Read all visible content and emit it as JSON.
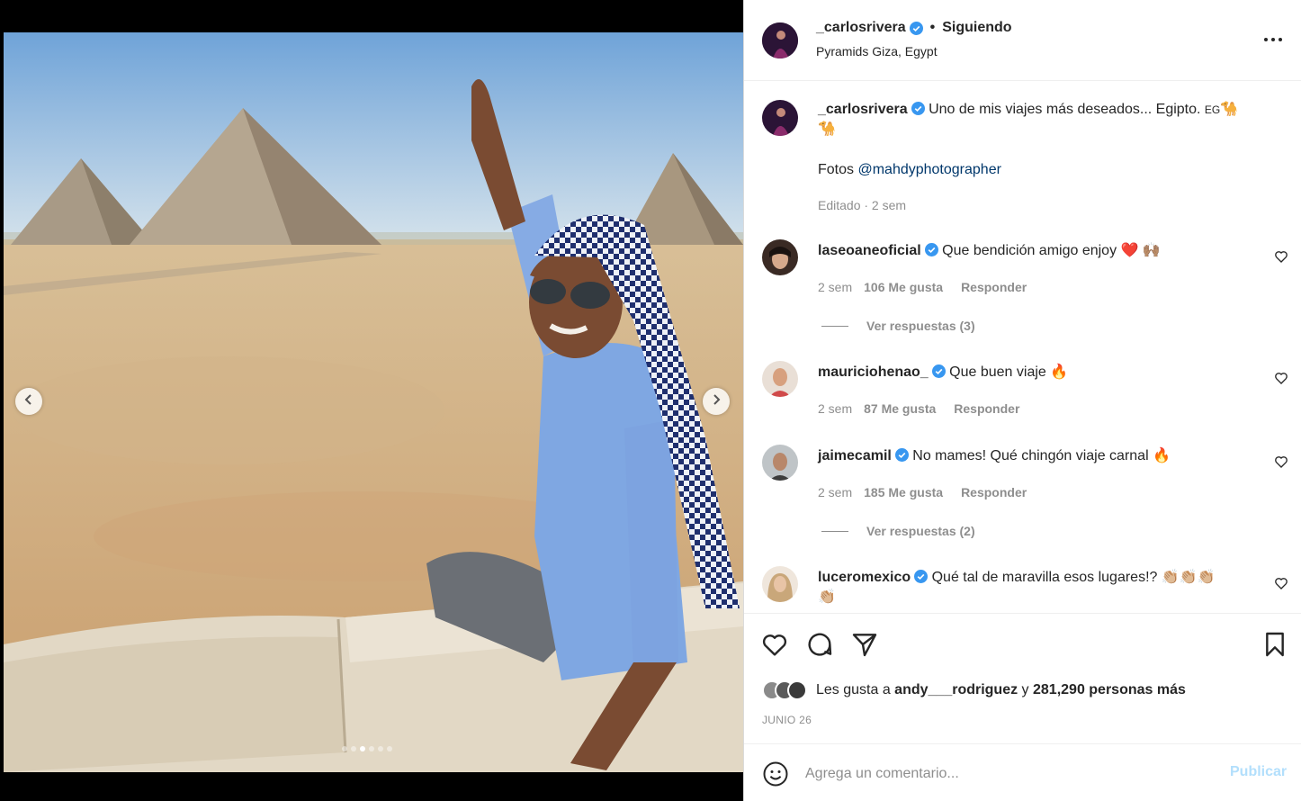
{
  "post": {
    "author": "_carlosrivera",
    "separator": "•",
    "follow_status": "Siguiendo",
    "location": "Pyramids Giza, Egypt"
  },
  "caption": {
    "author": "_carlosrivera",
    "text": "Uno de mis viajes más deseados... Egipto.",
    "flag": "EG",
    "emoji_1": "🐪",
    "emoji_2": "🐪",
    "credit_prefix": "Fotos ",
    "credit_handle": "@mahdyphotographer",
    "meta": "Editado · 2 sem"
  },
  "comments": [
    {
      "user": "laseoaneoficial",
      "text": "Que bendición amigo enjoy",
      "emoji": "❤️ 🙌🏽",
      "age": "2 sem",
      "likes": "106 Me gusta",
      "reply": "Responder",
      "view_replies": "Ver respuestas (3)"
    },
    {
      "user": "mauriciohenao_",
      "text": "Que buen viaje",
      "emoji": "🔥",
      "age": "2 sem",
      "likes": "87 Me gusta",
      "reply": "Responder"
    },
    {
      "user": "jaimecamil",
      "text": "No mames! Qué chingón viaje carnal",
      "emoji": "🔥",
      "age": "2 sem",
      "likes": "185 Me gusta",
      "reply": "Responder",
      "view_replies": "Ver respuestas (2)"
    },
    {
      "user": "luceromexico",
      "text": "Qué tal de maravilla esos lugares!?",
      "emoji": "👏🏼👏🏼👏🏼",
      "emoji_wrap": "👏🏼"
    }
  ],
  "likes": {
    "prefix": "Les gusta a ",
    "user": "andy___rodriguez",
    "middle": " y ",
    "count": "281,290 personas más"
  },
  "date": "JUNIO 26",
  "comment_box": {
    "placeholder": "Agrega un comentario...",
    "publish": "Publicar"
  },
  "carousel": {
    "total": 6,
    "active": 3
  },
  "colors": {
    "verified": "#3897f0",
    "link": "#00376b",
    "muted": "#8e8e8e",
    "publish_disabled": "#b2dffc"
  },
  "icons": [
    "more-options-icon",
    "heart-icon",
    "comment-icon",
    "share-icon",
    "bookmark-icon",
    "emoji-icon",
    "chevron-left-icon",
    "chevron-right-icon",
    "verified-badge-icon"
  ]
}
